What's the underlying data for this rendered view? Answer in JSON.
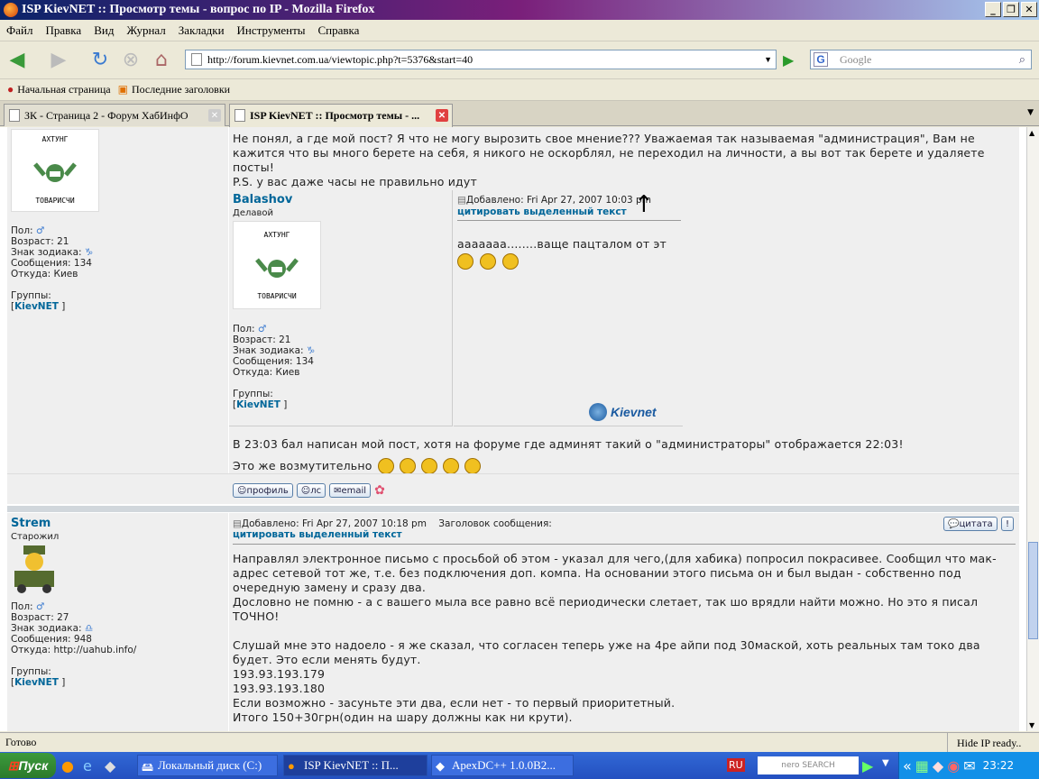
{
  "window": {
    "title": "ISP KievNET :: Просмотр темы - вопрос по IP - Mozilla Firefox"
  },
  "menu": [
    "Файл",
    "Правка",
    "Вид",
    "Журнал",
    "Закладки",
    "Инструменты",
    "Справка"
  ],
  "nav": {
    "url": "http://forum.kievnet.com.ua/viewtopic.php?t=5376&start=40",
    "search_placeholder": "Google"
  },
  "bookmarks": [
    "Начальная страница",
    "Последние заголовки"
  ],
  "tabs": [
    {
      "label": "ЗК - Страница 2 - Форум ХабИнфО"
    },
    {
      "label": "ISP KievNET :: Просмотр темы - ..."
    }
  ],
  "post1": {
    "text": "Не понял, а где мой пост? Я что не могу вырозить свое мнение??? Уважаемая так называемая \"администрация\", Вам не кажится что вы много берете на себя, я никого не оскорблял, не переходил на личности, а вы вот так берете и удаляете посты!",
    "ps": "P.S. у вас даже часы не правильно идут",
    "author": {
      "avatar_top": "АХТУНГ",
      "avatar_bottom": "ТОВАРИСЧИ",
      "gender": "Пол:",
      "age": "Возраст: 21",
      "zodiac": "Знак зодиака:",
      "posts": "Сообщения: 134",
      "from": "Откуда: Киев",
      "groups": "Группы:",
      "group": "KievNET",
      "group_l": "[",
      "group_r": " ]"
    },
    "quoted": {
      "name": "Balashov",
      "rank": "Делавой",
      "age": "Возраст: 21",
      "zodiac": "Знак зодиака:",
      "posts": "Сообщения: 134",
      "from": "Откуда: Киев",
      "gender": "Пол:",
      "groups": "Группы:",
      "group": "KievNET",
      "group_l": "[",
      "group_r": " ]",
      "avatar_top": "АХТУНГ",
      "avatar_bottom": "ТОВАРИСЧИ",
      "date": "Добавлено: Fri Apr 27, 2007 10:03 pm",
      "quote_link": "цитировать выделенный текст",
      "body": "ааааааа........ваще пацталом от эт",
      "logo": "Kievnet"
    },
    "after1": "В 23:03 бал написан мой пост, хотя на форуме где админят такий о \"администраторы\" отображается 22:03!",
    "after2": "Это же возмутительно",
    "buttons": [
      "профиль",
      "лс",
      "email"
    ]
  },
  "post2": {
    "author": "Strem",
    "rank": "Старожил",
    "gender": "Пол:",
    "age": "Возраст: 27",
    "zodiac": "Знак зодиака:",
    "posts": "Сообщения: 948",
    "from": "Откуда: http://uahub.info/",
    "groups": "Группы:",
    "group": "KievNET",
    "group_l": "[",
    "group_r": " ]",
    "date": "Добавлено: Fri Apr 27, 2007 10:18 pm",
    "subject": "Заголовок сообщения:",
    "quote_link": "цитировать выделенный текст",
    "quote_btn": "цитата",
    "lines": [
      "Направлял электронное письмо с просьбой об этом - указал для чего,(для хабика) попросил покрасивее. Сообщил что мак-адрес сетевой тот же, т.е. без подключения доп. компа. На основании этого письма он и был выдан - собственно под очередную замену и сразу два.",
      "Дословно не помню - а с вашего мыла все равно всё периодически слетает, так шо врядли найти можно. Но это я писал ТОЧНО!",
      "",
      "Слушай мне это надоело - я же сказал, что согласен теперь уже на 4ре айпи под 30маской, хоть реальных там токо два будет. Это если менять будут.",
      "193.93.193.179",
      "193.93.193.180",
      "Если возможно - засуньте эти два, если нет - то первый приоритетный.",
      "Итого 150+30грн(один на шару должны как ни крути)."
    ]
  },
  "status": {
    "left": "Готово",
    "right": "Hide IP ready.."
  },
  "taskbar": {
    "start": "Пуск",
    "items": [
      "Локальный диск (C:)",
      "ISP KievNET :: П...",
      "ApexDC++ 1.0.0B2..."
    ],
    "lang": "RU",
    "nero": "nero SEARCH",
    "clock": "23:22"
  }
}
